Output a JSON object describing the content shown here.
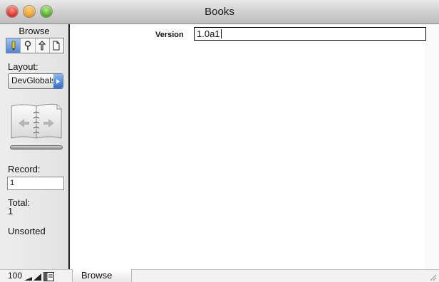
{
  "window": {
    "title": "Books"
  },
  "status_area": {
    "mode_label": "Browse",
    "tools": [
      {
        "icon": "pencil-icon",
        "active": true
      },
      {
        "icon": "magnifier-icon",
        "active": false
      },
      {
        "icon": "tsquare-icon",
        "active": false
      },
      {
        "icon": "page-icon",
        "active": false
      }
    ],
    "layout_label": "Layout:",
    "layout_value": "DevGlobals",
    "record_label": "Record:",
    "record_value": "1",
    "total_label": "Total:",
    "total_value": "1",
    "sort_status": "Unsorted"
  },
  "bottom_bar": {
    "zoom": "100",
    "mode": "Browse"
  },
  "content": {
    "fields": [
      {
        "label": "Version",
        "value": "1.0a1"
      }
    ]
  }
}
